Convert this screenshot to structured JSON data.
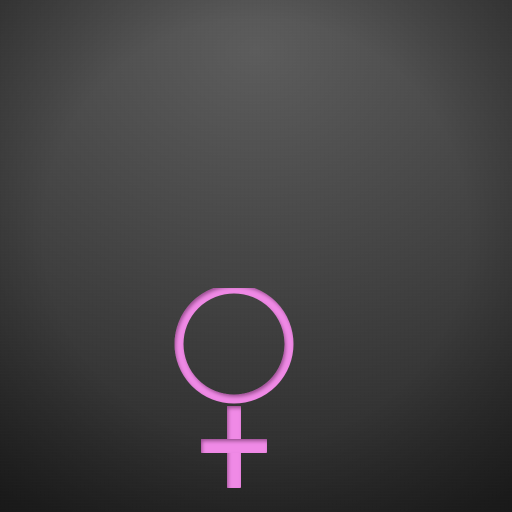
{
  "background": {
    "center_color": "#5c5c5c",
    "edge_color": "#262626"
  },
  "symbol": {
    "icon": "female-sign-icon",
    "color": "#f08ae6",
    "shadow_color": "#7a2f70"
  }
}
